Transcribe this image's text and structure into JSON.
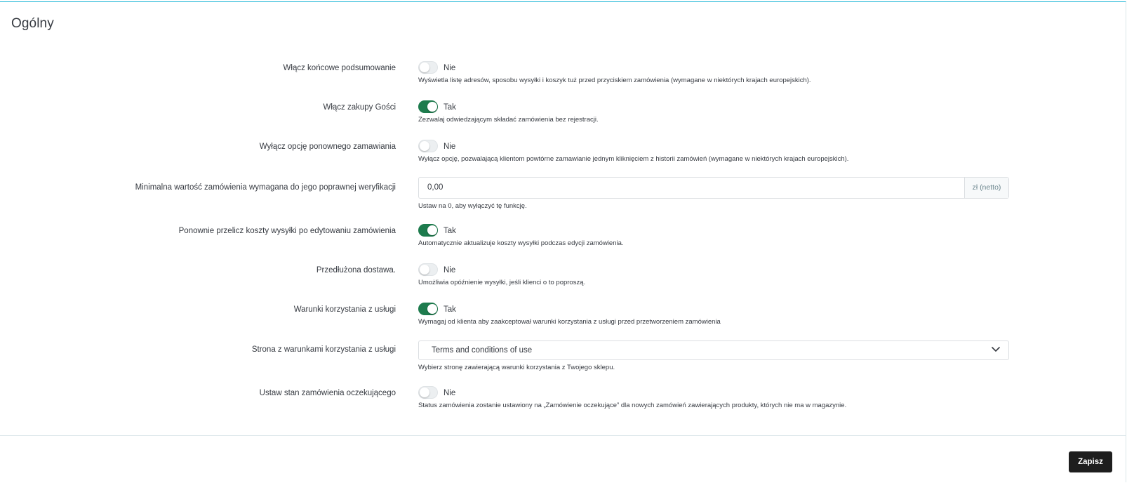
{
  "panel": {
    "title": "Ogólny"
  },
  "fields": [
    {
      "label": "Włącz końcowe podsumowanie",
      "state": "off",
      "state_text": "Nie",
      "help": "Wyświetla listę adresów, sposobu wysyłki i koszyk tuż przed przyciskiem zamówienia (wymagane w niektórych krajach europejskich)."
    },
    {
      "label": "Włącz zakupy Gości",
      "state": "on",
      "state_text": "Tak",
      "help": "Zezwalaj odwiedzającym składać zamówienia bez rejestracji."
    },
    {
      "label": "Wyłącz opcję ponownego zamawiania",
      "state": "off",
      "state_text": "Nie",
      "help": "Wyłącz opcję, pozwalającą klientom powtórne zamawianie jednym kliknięciem z historii zamówień (wymagane w niektórych krajach europejskich)."
    },
    {
      "label": "Minimalna wartość zamówienia wymagana do jego poprawnej weryfikacji",
      "value": "0,00",
      "addon": "zł (netto)",
      "help": "Ustaw na 0, aby wyłączyć tę funkcję."
    },
    {
      "label": "Ponownie przelicz koszty wysyłki po edytowaniu zamówienia",
      "state": "on",
      "state_text": "Tak",
      "help": "Automatycznie aktualizuje koszty wysyłki podczas edycji zamówienia."
    },
    {
      "label": "Przedłużona dostawa.",
      "state": "off",
      "state_text": "Nie",
      "help": "Umożliwia opóźnienie wysyłki, jeśli klienci o to poproszą."
    },
    {
      "label": "Warunki korzystania z usługi",
      "state": "on",
      "state_text": "Tak",
      "help": "Wymagaj od klienta aby zaakceptował warunki korzystania z usługi przed przetworzeniem zamówienia"
    },
    {
      "label": "Strona z warunkami korzystania z usługi",
      "selected": "Terms and conditions of use",
      "help": "Wybierz stronę zawierającą warunki korzystania z Twojego sklepu."
    },
    {
      "label": "Ustaw stan zamówienia oczekującego",
      "state": "off",
      "state_text": "Nie",
      "help": "Status zamówienia zostanie ustawiony na „Zamówienie oczekujące” dla nowych zamówień zawierających produkty, których nie ma w magazynie."
    }
  ],
  "footer": {
    "save_label": "Zapisz"
  },
  "colors": {
    "switch_on": "#1d7b4d",
    "switch_off": "#eceff1",
    "primary_button": "#1e1e1e",
    "panel_accent": "#25b9d7"
  }
}
